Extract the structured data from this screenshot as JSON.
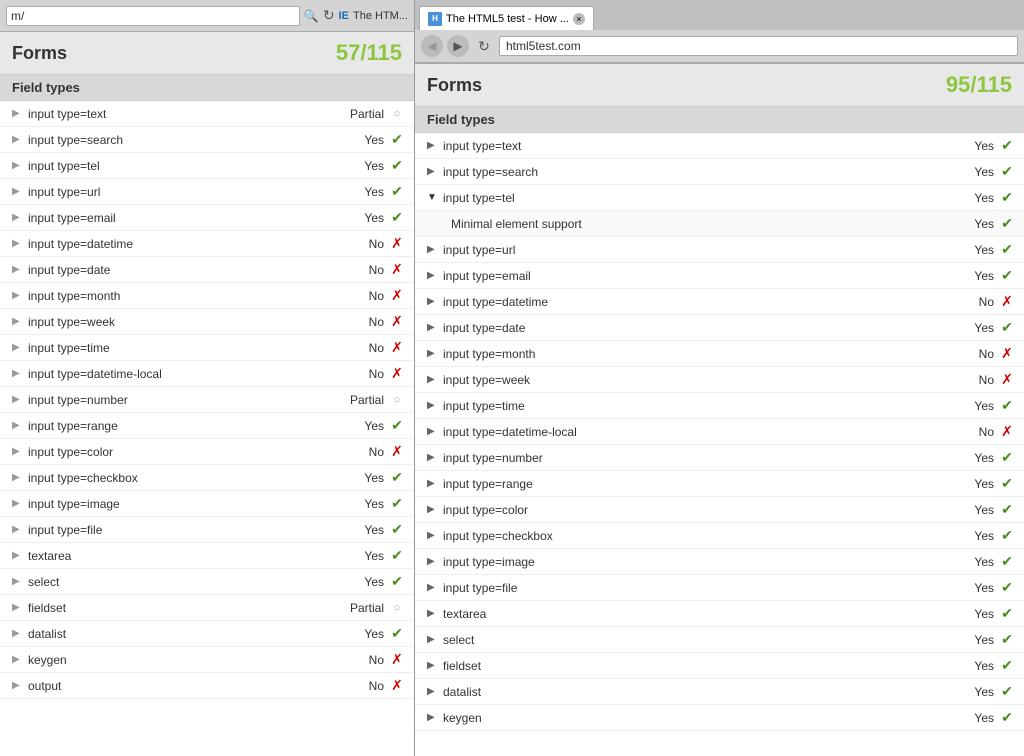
{
  "leftPanel": {
    "addressBar": "m/",
    "title": "Forms",
    "score": "57/115",
    "sectionHeader": "Field types",
    "fields": [
      {
        "name": "input type=text",
        "status": "Partial",
        "icon": "partial",
        "expanded": false
      },
      {
        "name": "input type=search",
        "status": "Yes",
        "icon": "yes",
        "expanded": false
      },
      {
        "name": "input type=tel",
        "status": "Yes",
        "icon": "yes",
        "expanded": false
      },
      {
        "name": "input type=url",
        "status": "Yes",
        "icon": "yes",
        "expanded": false
      },
      {
        "name": "input type=email",
        "status": "Yes",
        "icon": "yes",
        "expanded": false
      },
      {
        "name": "input type=datetime",
        "status": "No",
        "icon": "no",
        "expanded": false
      },
      {
        "name": "input type=date",
        "status": "No",
        "icon": "no",
        "expanded": false
      },
      {
        "name": "input type=month",
        "status": "No",
        "icon": "no",
        "expanded": false
      },
      {
        "name": "input type=week",
        "status": "No",
        "icon": "no",
        "expanded": false
      },
      {
        "name": "input type=time",
        "status": "No",
        "icon": "no",
        "expanded": false
      },
      {
        "name": "input type=datetime-local",
        "status": "No",
        "icon": "no",
        "expanded": false
      },
      {
        "name": "input type=number",
        "status": "Partial",
        "icon": "partial",
        "expanded": false
      },
      {
        "name": "input type=range",
        "status": "Yes",
        "icon": "yes",
        "expanded": false
      },
      {
        "name": "input type=color",
        "status": "No",
        "icon": "no",
        "expanded": false
      },
      {
        "name": "input type=checkbox",
        "status": "Yes",
        "icon": "yes",
        "expanded": false
      },
      {
        "name": "input type=image",
        "status": "Yes",
        "icon": "yes",
        "expanded": false
      },
      {
        "name": "input type=file",
        "status": "Yes",
        "icon": "yes",
        "expanded": false
      },
      {
        "name": "textarea",
        "status": "Yes",
        "icon": "yes",
        "expanded": false
      },
      {
        "name": "select",
        "status": "Yes",
        "icon": "yes",
        "expanded": false
      },
      {
        "name": "fieldset",
        "status": "Partial",
        "icon": "partial",
        "expanded": false
      },
      {
        "name": "datalist",
        "status": "Yes",
        "icon": "yes",
        "expanded": false
      },
      {
        "name": "keygen",
        "status": "No",
        "icon": "no",
        "expanded": false
      },
      {
        "name": "output",
        "status": "No",
        "icon": "no",
        "expanded": false
      }
    ]
  },
  "rightPanel": {
    "tabLabel": "The HTML5 test - How ...",
    "addressBar": "html5test.com",
    "title": "Forms",
    "score": "95/115",
    "sectionHeader": "Field types",
    "fields": [
      {
        "name": "input type=text",
        "status": "Yes",
        "icon": "yes",
        "expanded": false,
        "subItems": []
      },
      {
        "name": "input type=search",
        "status": "Yes",
        "icon": "yes",
        "expanded": false,
        "subItems": []
      },
      {
        "name": "input type=tel",
        "status": "Yes",
        "icon": "yes",
        "expanded": true,
        "subItems": [
          {
            "name": "Minimal element support",
            "status": "Yes",
            "icon": "yes"
          }
        ]
      },
      {
        "name": "input type=url",
        "status": "Yes",
        "icon": "yes",
        "expanded": false,
        "subItems": []
      },
      {
        "name": "input type=email",
        "status": "Yes",
        "icon": "yes",
        "expanded": false,
        "subItems": []
      },
      {
        "name": "input type=datetime",
        "status": "No",
        "icon": "no",
        "expanded": false,
        "subItems": []
      },
      {
        "name": "input type=date",
        "status": "Yes",
        "icon": "yes",
        "expanded": false,
        "subItems": []
      },
      {
        "name": "input type=month",
        "status": "No",
        "icon": "no",
        "expanded": false,
        "subItems": []
      },
      {
        "name": "input type=week",
        "status": "No",
        "icon": "no",
        "expanded": false,
        "subItems": []
      },
      {
        "name": "input type=time",
        "status": "Yes",
        "icon": "yes",
        "expanded": false,
        "subItems": []
      },
      {
        "name": "input type=datetime-local",
        "status": "No",
        "icon": "no",
        "expanded": false,
        "subItems": []
      },
      {
        "name": "input type=number",
        "status": "Yes",
        "icon": "yes",
        "expanded": false,
        "subItems": []
      },
      {
        "name": "input type=range",
        "status": "Yes",
        "icon": "yes",
        "expanded": false,
        "subItems": []
      },
      {
        "name": "input type=color",
        "status": "Yes",
        "icon": "yes",
        "expanded": false,
        "subItems": []
      },
      {
        "name": "input type=checkbox",
        "status": "Yes",
        "icon": "yes",
        "expanded": false,
        "subItems": []
      },
      {
        "name": "input type=image",
        "status": "Yes",
        "icon": "yes",
        "expanded": false,
        "subItems": []
      },
      {
        "name": "input type=file",
        "status": "Yes",
        "icon": "yes",
        "expanded": false,
        "subItems": []
      },
      {
        "name": "textarea",
        "status": "Yes",
        "icon": "yes",
        "expanded": false,
        "subItems": []
      },
      {
        "name": "select",
        "status": "Yes",
        "icon": "yes",
        "expanded": false,
        "subItems": []
      },
      {
        "name": "fieldset",
        "status": "Yes",
        "icon": "yes",
        "expanded": false,
        "subItems": []
      },
      {
        "name": "datalist",
        "status": "Yes",
        "icon": "yes",
        "expanded": false,
        "subItems": []
      },
      {
        "name": "keygen",
        "status": "Yes",
        "icon": "yes",
        "expanded": false,
        "subItems": []
      }
    ]
  },
  "icons": {
    "yes_check": "✔",
    "no_x": "✗",
    "partial_circle": "○",
    "arrow_right": "▶",
    "arrow_down": "▼",
    "back": "◀",
    "forward": "▶",
    "refresh": "↻",
    "close": "×"
  }
}
